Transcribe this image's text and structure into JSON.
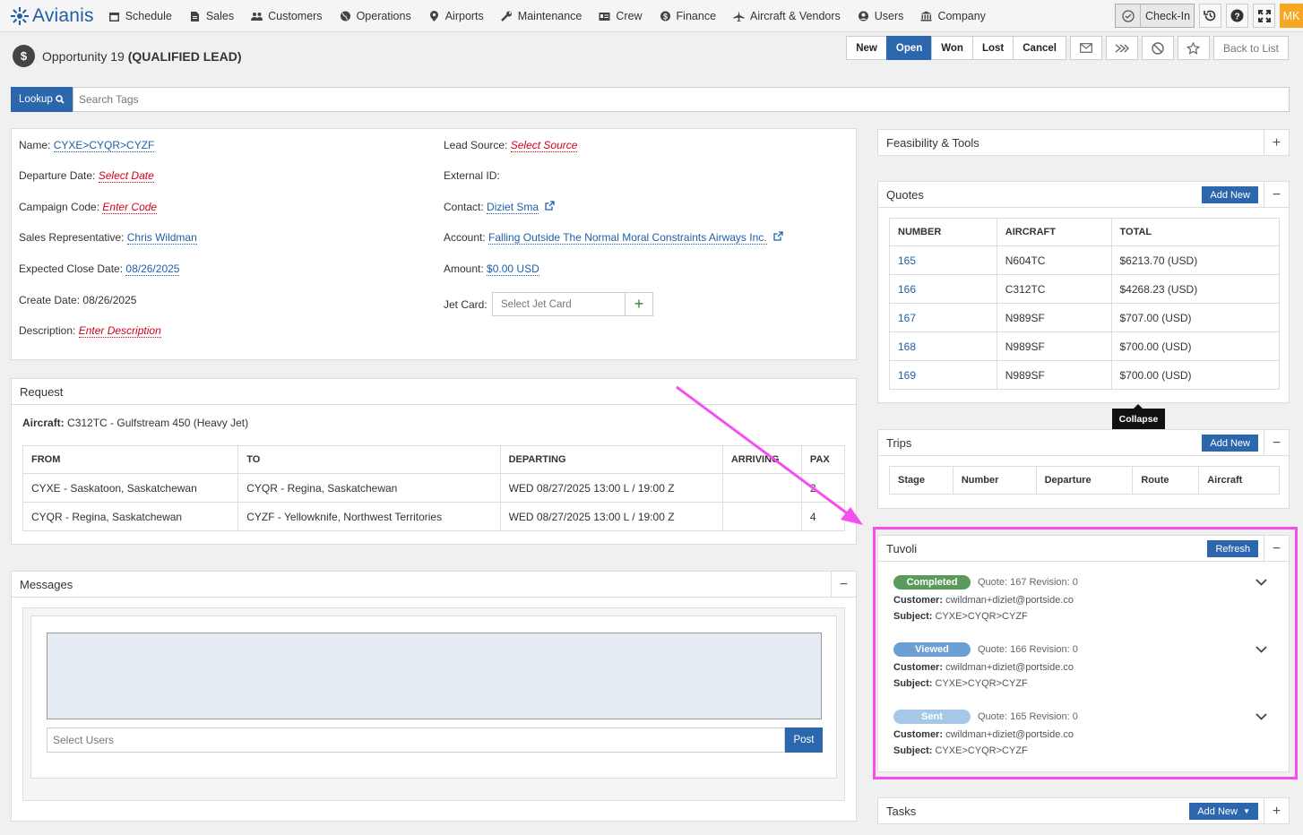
{
  "nav": {
    "brand": "Avianis",
    "items": [
      {
        "label": "Schedule",
        "icon": "calendar-icon"
      },
      {
        "label": "Sales",
        "icon": "document-icon"
      },
      {
        "label": "Customers",
        "icon": "users-icon"
      },
      {
        "label": "Operations",
        "icon": "globe-icon"
      },
      {
        "label": "Airports",
        "icon": "map-pin-icon"
      },
      {
        "label": "Maintenance",
        "icon": "wrench-icon"
      },
      {
        "label": "Crew",
        "icon": "id-card-icon"
      },
      {
        "label": "Finance",
        "icon": "dollar-icon"
      },
      {
        "label": "Aircraft & Vendors",
        "icon": "plane-icon"
      },
      {
        "label": "Users",
        "icon": "user-icon"
      },
      {
        "label": "Company",
        "icon": "building-icon"
      }
    ],
    "checkin_label": "Check-In",
    "avatar": "MK"
  },
  "header": {
    "title": "Opportunity 19",
    "status": "(QUALIFIED LEAD)",
    "buttons": [
      "New",
      "Open",
      "Won",
      "Lost",
      "Cancel"
    ],
    "active": "Open",
    "back_label": "Back to List"
  },
  "lookup": {
    "label": "Lookup",
    "placeholder": "Search Tags"
  },
  "info": {
    "name_label": "Name:",
    "name": "CYXE>CYQR>CYZF",
    "departure_label": "Departure Date:",
    "departure": "Select Date",
    "campaign_label": "Campaign Code:",
    "campaign": "Enter Code",
    "rep_label": "Sales Representative:",
    "rep": "Chris Wildman",
    "close_label": "Expected Close Date:",
    "close": "08/26/2025",
    "create_label": "Create Date:",
    "create": "08/26/2025",
    "desc_label": "Description:",
    "desc": "Enter Description",
    "source_label": "Lead Source:",
    "source": "Select Source",
    "external_label": "External ID:",
    "contact_label": "Contact:",
    "contact": "Diziet Sma",
    "account_label": "Account:",
    "account": "Falling Outside The Normal Moral Constraints Airways Inc.",
    "amount_label": "Amount:",
    "amount": "$0.00 USD",
    "jet_label": "Jet Card:",
    "jet_placeholder": "Select Jet Card"
  },
  "request": {
    "title": "Request",
    "aircraft_label": "Aircraft:",
    "aircraft": "C312TC - Gulfstream 450 (Heavy Jet)",
    "columns": [
      "FROM",
      "TO",
      "DEPARTING",
      "ARRIVING",
      "PAX"
    ],
    "rows": [
      [
        "CYXE - Saskatoon, Saskatchewan",
        "CYQR - Regina, Saskatchewan",
        "WED 08/27/2025 13:00 L / 19:00 Z",
        "",
        "2"
      ],
      [
        "CYQR - Regina, Saskatchewan",
        "CYZF - Yellowknife, Northwest Territories",
        "WED 08/27/2025 13:00 L / 19:00 Z",
        "",
        "4"
      ]
    ]
  },
  "messages": {
    "title": "Messages",
    "users_placeholder": "Select Users",
    "post_label": "Post"
  },
  "feasibility": {
    "title": "Feasibility & Tools"
  },
  "quotes": {
    "title": "Quotes",
    "add_label": "Add New",
    "columns": [
      "NUMBER",
      "AIRCRAFT",
      "TOTAL"
    ],
    "rows": [
      [
        "165",
        "N604TC",
        "$6213.70 (USD)"
      ],
      [
        "166",
        "C312TC",
        "$4268.23 (USD)"
      ],
      [
        "167",
        "N989SF",
        "$707.00 (USD)"
      ],
      [
        "168",
        "N989SF",
        "$700.00 (USD)"
      ],
      [
        "169",
        "N989SF",
        "$700.00 (USD)"
      ]
    ],
    "tooltip": "Collapse"
  },
  "trips": {
    "title": "Trips",
    "add_label": "Add New",
    "columns": [
      "Stage",
      "Number",
      "Departure",
      "Route",
      "Aircraft"
    ]
  },
  "tuvoli": {
    "title": "Tuvoli",
    "refresh_label": "Refresh",
    "customer_label": "Customer:",
    "subject_label": "Subject:",
    "items": [
      {
        "status": "Completed",
        "color": "#5a9a5a",
        "quote": "Quote: 167 Revision: 0",
        "customer": "cwildman+diziet@portside.co",
        "subject": "CYXE>CYQR>CYZF"
      },
      {
        "status": "Viewed",
        "color": "#6b9fd6",
        "quote": "Quote: 166 Revision: 0",
        "customer": "cwildman+diziet@portside.co",
        "subject": "CYXE>CYQR>CYZF"
      },
      {
        "status": "Sent",
        "color": "#a6c8e8",
        "quote": "Quote: 165 Revision: 0",
        "customer": "cwildman+diziet@portside.co",
        "subject": "CYXE>CYQR>CYZF"
      }
    ]
  },
  "tasks": {
    "title": "Tasks",
    "add_label": "Add New"
  },
  "colors": {
    "accent": "#2c67ad",
    "highlight": "#f54ef0",
    "link": "#1f5fa8",
    "required": "#d0021b"
  }
}
